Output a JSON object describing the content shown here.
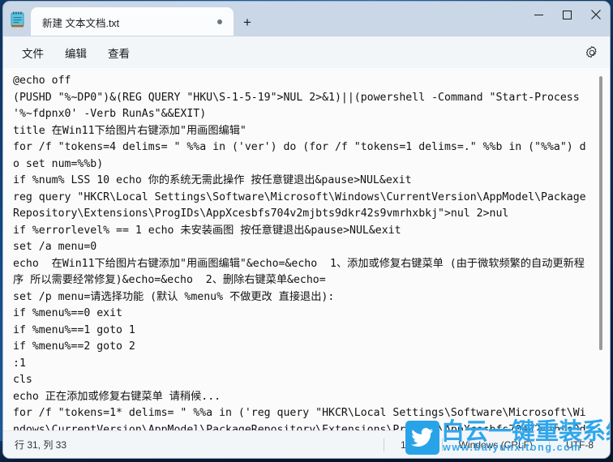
{
  "window": {
    "app_icon": "notepad-icon",
    "controls": {
      "minimize": "minimize-icon",
      "maximize": "maximize-icon",
      "close": "close-icon"
    }
  },
  "tabs": [
    {
      "title": "新建 文本文档.txt",
      "dirty": true
    }
  ],
  "newtab_label": "+",
  "menubar": {
    "items": [
      {
        "label": "文件",
        "name": "menu-file"
      },
      {
        "label": "编辑",
        "name": "menu-edit"
      },
      {
        "label": "查看",
        "name": "menu-view"
      }
    ],
    "settings_icon": "gear-icon"
  },
  "editor": {
    "content": "@echo off\n(PUSHD \"%~DP0\")&(REG QUERY \"HKU\\S-1-5-19\">NUL 2>&1)||(powershell -Command \"Start-Process '%~fdpnx0' -Verb RunAs\"&&EXIT)\ntitle 在Win11下给图片右键添加\"用画图编辑\"\nfor /f \"tokens=4 delims= \" %%a in ('ver') do (for /f \"tokens=1 delims=.\" %%b in (\"%%a\") do set num=%%b)\nif %num% LSS 10 echo 你的系统无需此操作 按任意键退出&pause>NUL&exit\nreg query \"HKCR\\Local Settings\\Software\\Microsoft\\Windows\\CurrentVersion\\AppModel\\PackageRepository\\Extensions\\ProgIDs\\AppXcesbfs704v2mjbts9dkr42s9vmrhxbkj\">nul 2>nul\nif %errorlevel% == 1 echo 未安装画图 按任意键退出&pause>NUL&exit\nset /a menu=0\necho  在Win11下给图片右键添加\"用画图编辑\"&echo=&echo  1、添加或修复右键菜单 (由于微软频繁的自动更新程序 所以需要经常修复)&echo=&echo  2、删除右键菜单&echo=\nset /p menu=请选择功能 (默认 %menu% 不做更改 直接退出):\nif %menu%==0 exit\nif %menu%==1 goto 1\nif %menu%==2 goto 2\n:1\ncls\necho 正在添加或修复右键菜单 请稍候...\nfor /f \"tokens=1* delims= \" %%a in ('reg query \"HKCR\\Local Settings\\Software\\Microsoft\\Windows\\CurrentVersion\\AppModel\\PackageRepository\\Extensions\\ProgIDs\\AppXcesbfs704v2mjbts9dkr42s9vmrhxbkj\"') do set mspaint=%ProgramFiles%\\WindowsApps\\%%a\\PaintApp\\mspaint.exe"
  },
  "statusbar": {
    "position": "行 31, 列 33",
    "zoom": "100%",
    "line_ending": "Windows (CRLF)",
    "encoding": "UTF-8"
  },
  "watermark": {
    "title": "白云一键重装系统",
    "url": "www.baiyunxitong.com",
    "icon": "bird-icon",
    "color": "#2fa6ec"
  }
}
